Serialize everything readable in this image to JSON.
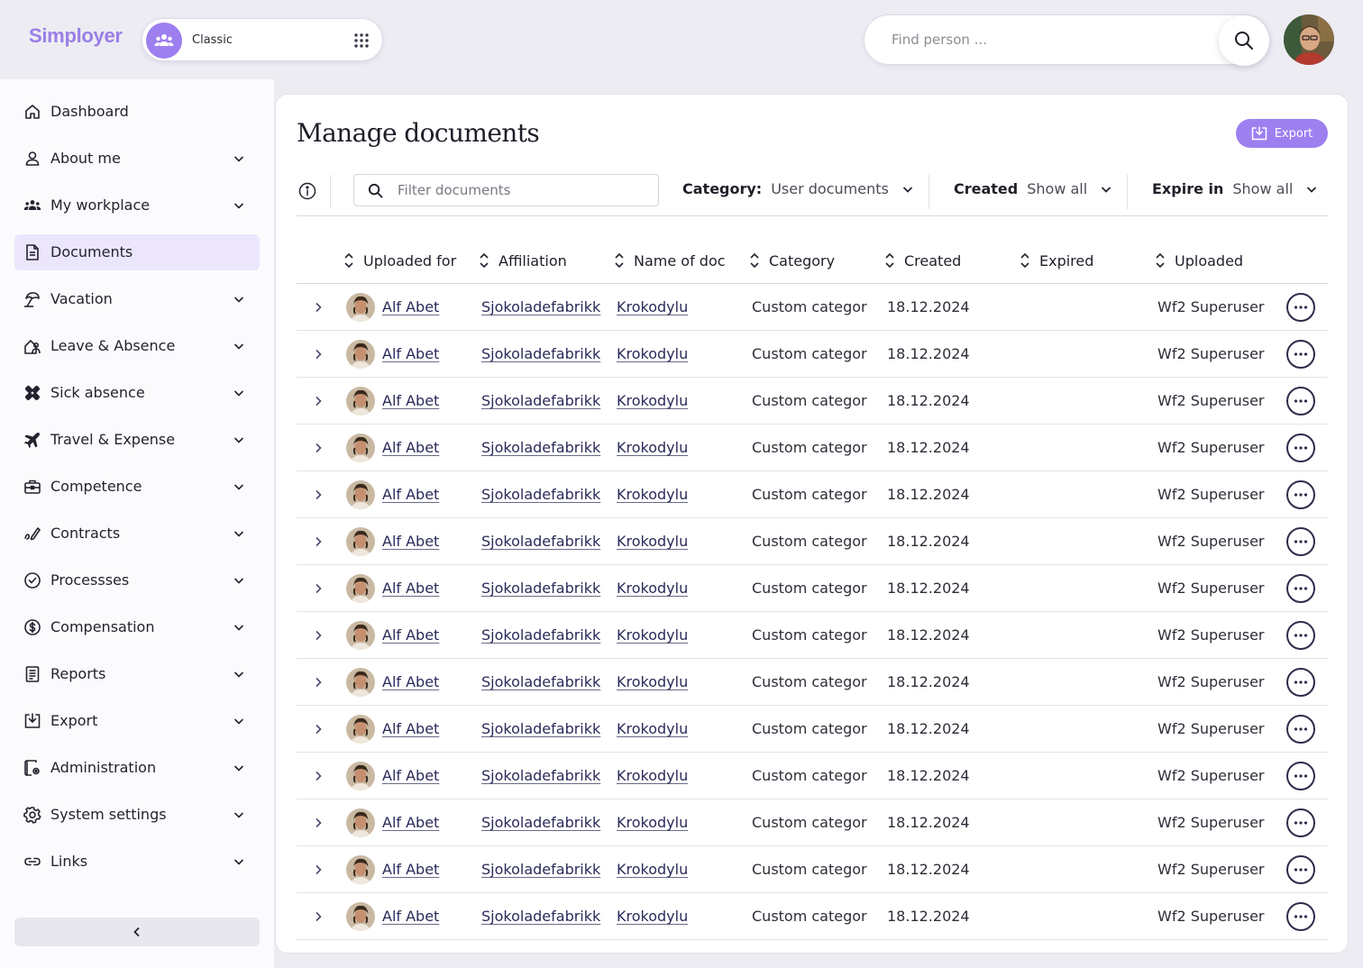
{
  "app": {
    "logo": "Simployer",
    "mode_label": "Classic",
    "search_placeholder": "Find person ...",
    "accent_color": "#9d7ff0"
  },
  "sidebar": {
    "items": [
      {
        "label": "Dashboard",
        "icon": "home-icon",
        "chevron": false,
        "active": false
      },
      {
        "label": "About me",
        "icon": "user-icon",
        "chevron": true,
        "active": false
      },
      {
        "label": "My workplace",
        "icon": "team-icon",
        "chevron": true,
        "active": false
      },
      {
        "label": "Documents",
        "icon": "document-icon",
        "chevron": false,
        "active": true
      },
      {
        "label": "Vacation",
        "icon": "umbrella-icon",
        "chevron": true,
        "active": false
      },
      {
        "label": "Leave & Absence",
        "icon": "leave-icon",
        "chevron": true,
        "active": false
      },
      {
        "label": "Sick absence",
        "icon": "bandage-icon",
        "chevron": true,
        "active": false
      },
      {
        "label": "Travel & Expense",
        "icon": "plane-icon",
        "chevron": true,
        "active": false
      },
      {
        "label": "Competence",
        "icon": "briefcase-icon",
        "chevron": true,
        "active": false
      },
      {
        "label": "Contracts",
        "icon": "signature-icon",
        "chevron": true,
        "active": false
      },
      {
        "label": "Processses",
        "icon": "check-circle-icon",
        "chevron": true,
        "active": false
      },
      {
        "label": "Compensation",
        "icon": "dollar-icon",
        "chevron": true,
        "active": false
      },
      {
        "label": "Reports",
        "icon": "report-icon",
        "chevron": true,
        "active": false
      },
      {
        "label": "Export",
        "icon": "export-icon",
        "chevron": true,
        "active": false
      },
      {
        "label": "Administration",
        "icon": "admin-icon",
        "chevron": true,
        "active": false
      },
      {
        "label": "System settings",
        "icon": "gear-icon",
        "chevron": true,
        "active": false
      },
      {
        "label": "Links",
        "icon": "link-icon",
        "chevron": true,
        "active": false
      }
    ]
  },
  "main": {
    "title": "Manage documents",
    "export_label": "Export",
    "filter_placeholder": "Filter documents",
    "filters": {
      "category_label": "Category:",
      "category_value": "User documents",
      "created_label": "Created",
      "created_value": "Show all",
      "expire_label": "Expire in",
      "expire_value": "Show all"
    },
    "columns": [
      "Uploaded for",
      "Affiliation",
      "Name of doc",
      "Category",
      "Created",
      "Expired",
      "Uploaded"
    ],
    "rows": [
      {
        "uploaded_for": "Alf Abet",
        "affiliation": "Sjokoladefabrikk",
        "name_of_doc": "Krokodylu",
        "category": "Custom categor",
        "created": "18.12.2024",
        "expired": "",
        "uploaded": "Wf2 Superuser"
      },
      {
        "uploaded_for": "Alf Abet",
        "affiliation": "Sjokoladefabrikk",
        "name_of_doc": "Krokodylu",
        "category": "Custom categor",
        "created": "18.12.2024",
        "expired": "",
        "uploaded": "Wf2 Superuser"
      },
      {
        "uploaded_for": "Alf Abet",
        "affiliation": "Sjokoladefabrikk",
        "name_of_doc": "Krokodylu",
        "category": "Custom categor",
        "created": "18.12.2024",
        "expired": "",
        "uploaded": "Wf2 Superuser"
      },
      {
        "uploaded_for": "Alf Abet",
        "affiliation": "Sjokoladefabrikk",
        "name_of_doc": "Krokodylu",
        "category": "Custom categor",
        "created": "18.12.2024",
        "expired": "",
        "uploaded": "Wf2 Superuser"
      },
      {
        "uploaded_for": "Alf Abet",
        "affiliation": "Sjokoladefabrikk",
        "name_of_doc": "Krokodylu",
        "category": "Custom categor",
        "created": "18.12.2024",
        "expired": "",
        "uploaded": "Wf2 Superuser"
      },
      {
        "uploaded_for": "Alf Abet",
        "affiliation": "Sjokoladefabrikk",
        "name_of_doc": "Krokodylu",
        "category": "Custom categor",
        "created": "18.12.2024",
        "expired": "",
        "uploaded": "Wf2 Superuser"
      },
      {
        "uploaded_for": "Alf Abet",
        "affiliation": "Sjokoladefabrikk",
        "name_of_doc": "Krokodylu",
        "category": "Custom categor",
        "created": "18.12.2024",
        "expired": "",
        "uploaded": "Wf2 Superuser"
      },
      {
        "uploaded_for": "Alf Abet",
        "affiliation": "Sjokoladefabrikk",
        "name_of_doc": "Krokodylu",
        "category": "Custom categor",
        "created": "18.12.2024",
        "expired": "",
        "uploaded": "Wf2 Superuser"
      },
      {
        "uploaded_for": "Alf Abet",
        "affiliation": "Sjokoladefabrikk",
        "name_of_doc": "Krokodylu",
        "category": "Custom categor",
        "created": "18.12.2024",
        "expired": "",
        "uploaded": "Wf2 Superuser"
      },
      {
        "uploaded_for": "Alf Abet",
        "affiliation": "Sjokoladefabrikk",
        "name_of_doc": "Krokodylu",
        "category": "Custom categor",
        "created": "18.12.2024",
        "expired": "",
        "uploaded": "Wf2 Superuser"
      },
      {
        "uploaded_for": "Alf Abet",
        "affiliation": "Sjokoladefabrikk",
        "name_of_doc": "Krokodylu",
        "category": "Custom categor",
        "created": "18.12.2024",
        "expired": "",
        "uploaded": "Wf2 Superuser"
      },
      {
        "uploaded_for": "Alf Abet",
        "affiliation": "Sjokoladefabrikk",
        "name_of_doc": "Krokodylu",
        "category": "Custom categor",
        "created": "18.12.2024",
        "expired": "",
        "uploaded": "Wf2 Superuser"
      },
      {
        "uploaded_for": "Alf Abet",
        "affiliation": "Sjokoladefabrikk",
        "name_of_doc": "Krokodylu",
        "category": "Custom categor",
        "created": "18.12.2024",
        "expired": "",
        "uploaded": "Wf2 Superuser"
      },
      {
        "uploaded_for": "Alf Abet",
        "affiliation": "Sjokoladefabrikk",
        "name_of_doc": "Krokodylu",
        "category": "Custom categor",
        "created": "18.12.2024",
        "expired": "",
        "uploaded": "Wf2 Superuser"
      }
    ]
  }
}
